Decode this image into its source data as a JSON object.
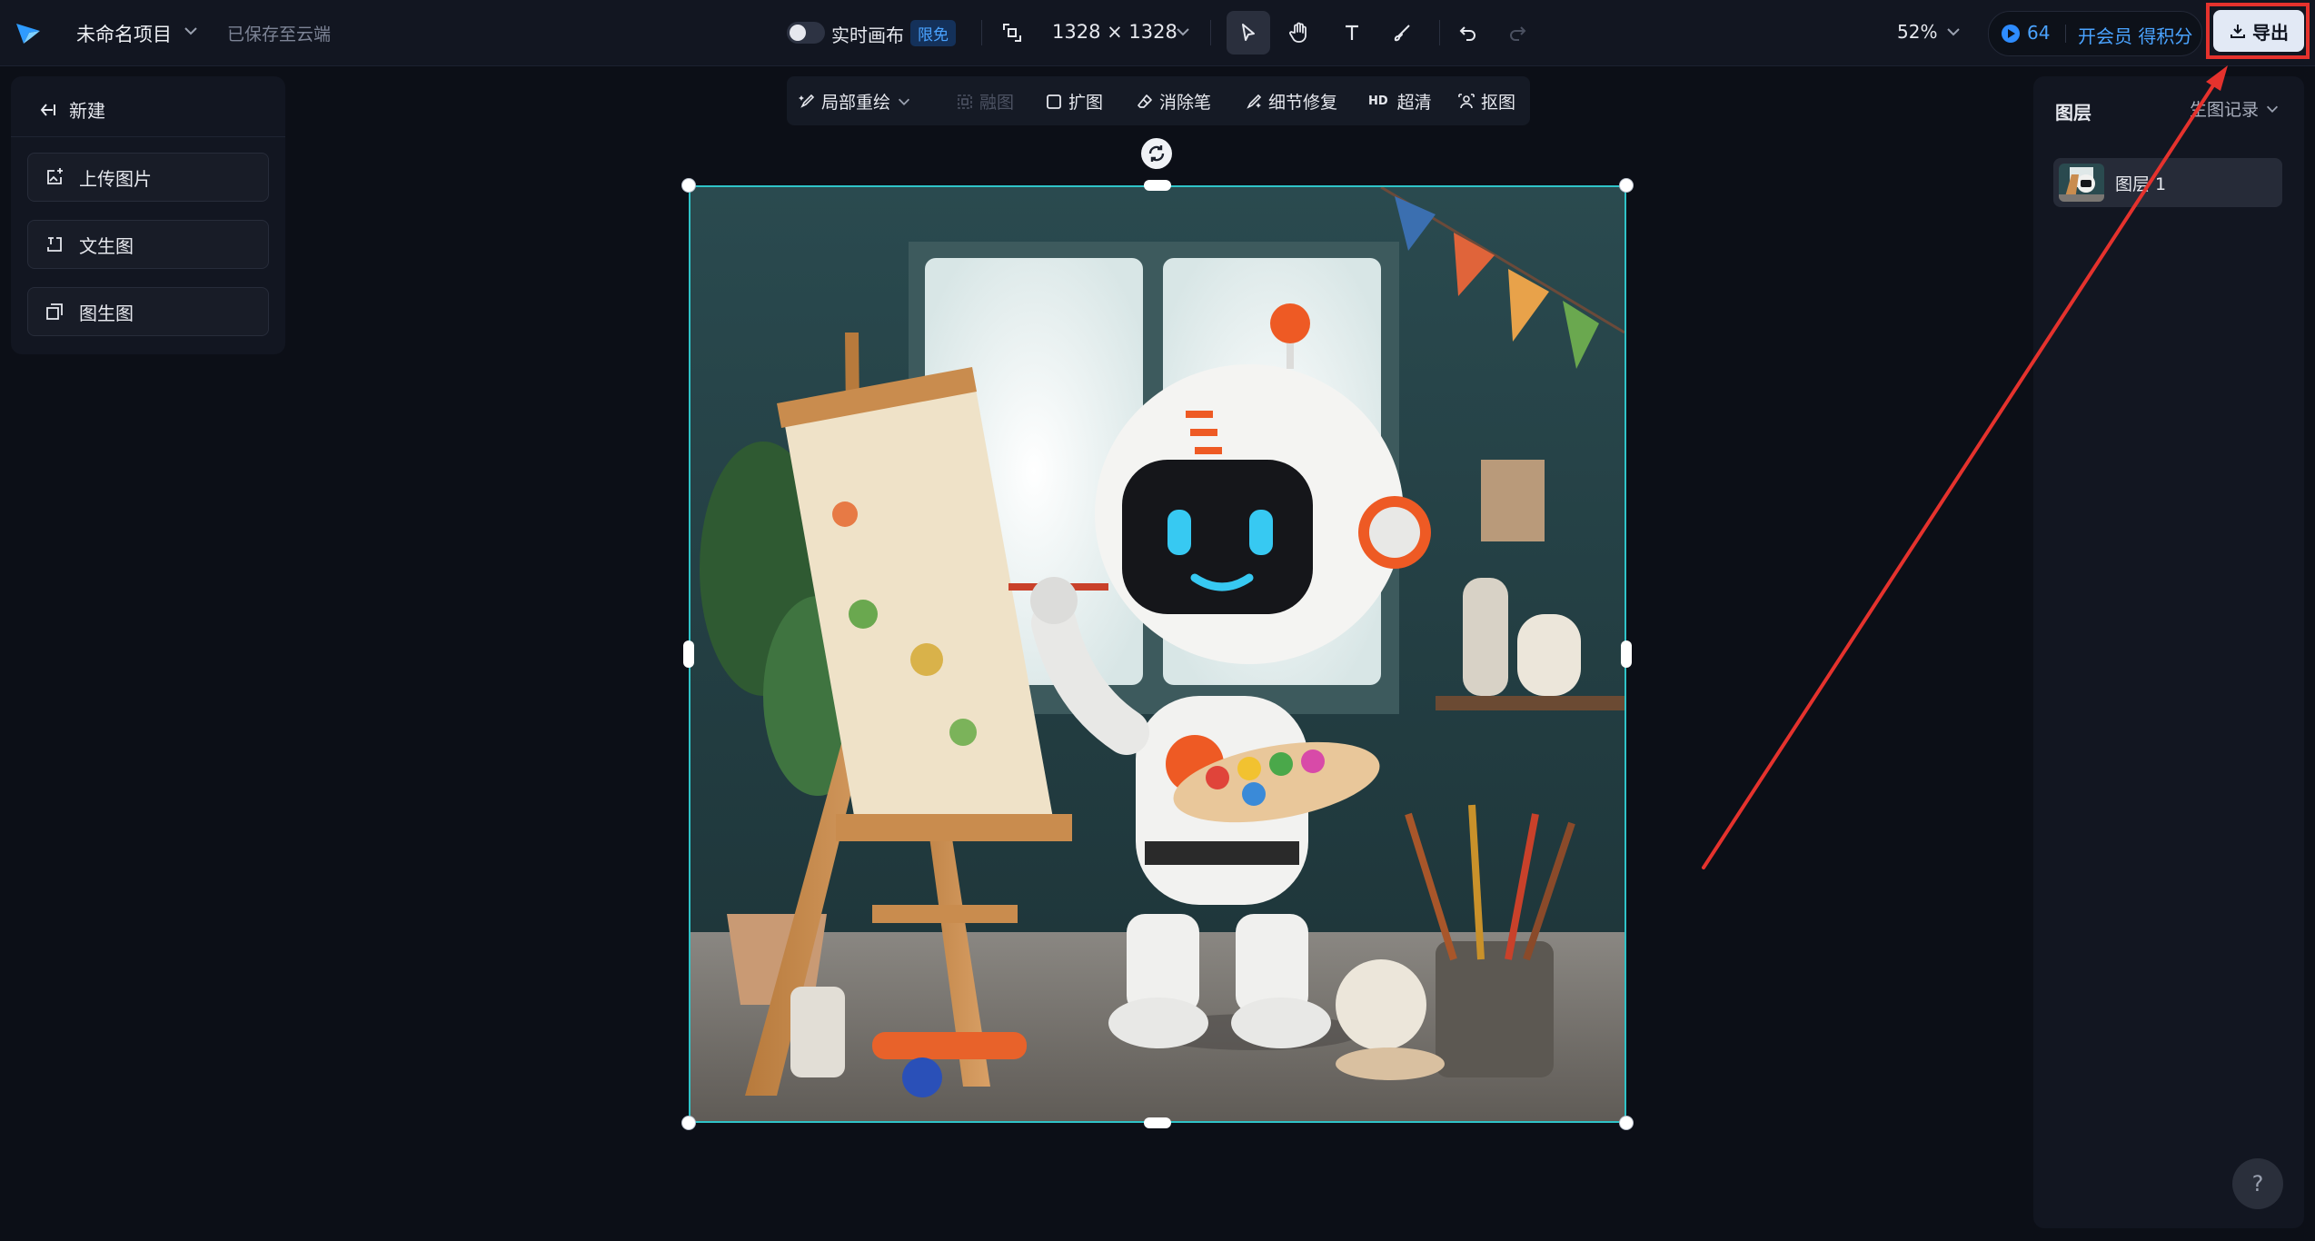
{
  "header": {
    "project_title": "未命名项目",
    "save_status": "已保存至云端",
    "realtime_label": "实时画布",
    "realtime_badge": "限免",
    "canvas_size": "1328 × 1328",
    "zoom": "52%",
    "credits": "64",
    "member_cta": "开会员 得积分",
    "export_label": "导出"
  },
  "left_panel": {
    "new_label": "新建",
    "buttons": [
      {
        "label": "上传图片",
        "icon": "upload-image-icon"
      },
      {
        "label": "文生图",
        "icon": "text-to-image-icon"
      },
      {
        "label": "图生图",
        "icon": "image-to-image-icon"
      }
    ]
  },
  "edit_toolbar": {
    "items": [
      {
        "label": "局部重绘",
        "icon": "brush-magic-icon"
      },
      {
        "label": "融图",
        "icon": "blend-icon",
        "disabled": true
      },
      {
        "label": "扩图",
        "icon": "expand-icon"
      },
      {
        "label": "消除笔",
        "icon": "eraser-icon"
      },
      {
        "label": "细节修复",
        "icon": "detail-fix-icon"
      },
      {
        "label": "超清",
        "prefix": "HD"
      },
      {
        "label": "抠图",
        "icon": "cutout-icon"
      }
    ]
  },
  "right_panel": {
    "title": "图层",
    "history_label": "生图记录",
    "layers": [
      {
        "name": "图层 1"
      }
    ]
  },
  "help": {
    "label": "?"
  },
  "colors": {
    "accent": "#4aa3ff",
    "selection": "#2fc3c8",
    "annotation": "#e5322d"
  }
}
